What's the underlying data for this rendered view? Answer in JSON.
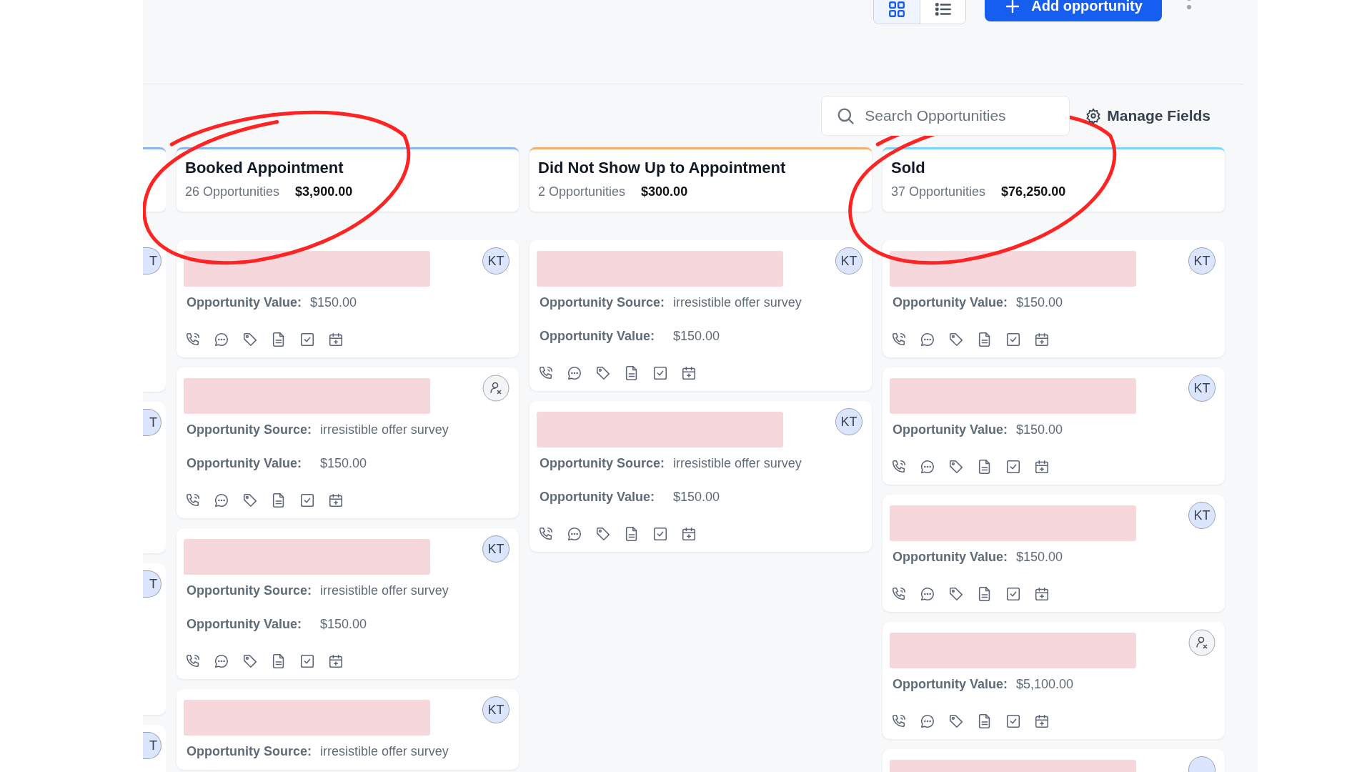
{
  "toolbar": {
    "view_toggle": [
      {
        "kind": "grid",
        "selected": true
      },
      {
        "kind": "list",
        "selected": false
      }
    ],
    "add_button": "Add opportunity"
  },
  "search": {
    "placeholder": "Search Opportunities"
  },
  "manage_fields": "Manage Fields",
  "partial_column": {
    "color": "#8ab4f8",
    "cards": [
      {
        "avatar": "T"
      },
      {
        "avatar": "T"
      },
      {
        "avatar": "T"
      },
      {
        "avatar": "T"
      }
    ]
  },
  "columns": [
    {
      "title": "Booked Appointment",
      "count": "26 Opportunities",
      "amount": "$3,900.00",
      "color": "#8ab4f8",
      "circled": true,
      "cards": [
        {
          "assignee": {
            "kind": "initials",
            "text": "KT"
          },
          "actions": true,
          "fields": [
            {
              "label": "Opportunity Value:",
              "value": "$150.00"
            }
          ]
        },
        {
          "assignee": {
            "kind": "unassigned"
          },
          "actions": true,
          "fields": [
            {
              "label": "Opportunity Source:",
              "value": "irresistible offer survey"
            },
            {
              "label": "Opportunity Value:",
              "value": "$150.00"
            }
          ]
        },
        {
          "assignee": {
            "kind": "initials",
            "text": "KT"
          },
          "actions": true,
          "fields": [
            {
              "label": "Opportunity Source:",
              "value": "irresistible offer survey"
            },
            {
              "label": "Opportunity Value:",
              "value": "$150.00"
            }
          ]
        },
        {
          "assignee": {
            "kind": "initials",
            "text": "KT"
          },
          "actions": false,
          "fields": [
            {
              "label": "Opportunity Source:",
              "value": "irresistible offer survey"
            }
          ]
        }
      ]
    },
    {
      "title": "Did Not Show Up to Appointment",
      "count": "2 Opportunities",
      "amount": "$300.00",
      "color": "#f6ad70",
      "circled": false,
      "cards": [
        {
          "assignee": {
            "kind": "initials",
            "text": "KT"
          },
          "actions": true,
          "fields": [
            {
              "label": "Opportunity Source:",
              "value": "irresistible offer survey"
            },
            {
              "label": "Opportunity Value:",
              "value": "$150.00"
            }
          ]
        },
        {
          "assignee": {
            "kind": "initials",
            "text": "KT"
          },
          "actions": true,
          "fields": [
            {
              "label": "Opportunity Source:",
              "value": "irresistible offer survey"
            },
            {
              "label": "Opportunity Value:",
              "value": "$150.00"
            }
          ]
        }
      ]
    },
    {
      "title": "Sold",
      "count": "37 Opportunities",
      "amount": "$76,250.00",
      "color": "#7dd3fc",
      "circled": true,
      "cards": [
        {
          "assignee": {
            "kind": "initials",
            "text": "KT"
          },
          "actions": true,
          "fields": [
            {
              "label": "Opportunity Value:",
              "value": "$150.00"
            }
          ]
        },
        {
          "assignee": {
            "kind": "initials",
            "text": "KT"
          },
          "actions": true,
          "fields": [
            {
              "label": "Opportunity Value:",
              "value": "$150.00"
            }
          ]
        },
        {
          "assignee": {
            "kind": "initials",
            "text": "KT"
          },
          "actions": true,
          "fields": [
            {
              "label": "Opportunity Value:",
              "value": "$150.00"
            }
          ]
        },
        {
          "assignee": {
            "kind": "unassigned"
          },
          "actions": true,
          "fields": [
            {
              "label": "Opportunity Value:",
              "value": "$5,100.00"
            }
          ]
        },
        {
          "assignee": {
            "kind": "initials"
          },
          "actions": false
        }
      ]
    }
  ]
}
